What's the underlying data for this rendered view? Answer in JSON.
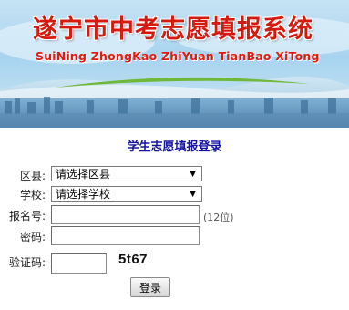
{
  "banner": {
    "title": "遂宁市中考志愿填报系统",
    "subtitle": "SuiNing ZhongKao ZhiYuan TianBao XiTong"
  },
  "form": {
    "title": "学生志愿填报登录",
    "district": {
      "label": "区县:",
      "selected": "请选择区县"
    },
    "school": {
      "label": "学校:",
      "selected": "请选择学校"
    },
    "registration": {
      "label": "报名号:",
      "value": "",
      "hint": "(12位)"
    },
    "password": {
      "label": "密码:",
      "value": ""
    },
    "captcha": {
      "label": "验证码:",
      "value": "",
      "code": "5t67"
    },
    "login_label": "登录"
  },
  "colors": {
    "title_red": "#d61a10",
    "form_title_blue": "#1414a0"
  }
}
